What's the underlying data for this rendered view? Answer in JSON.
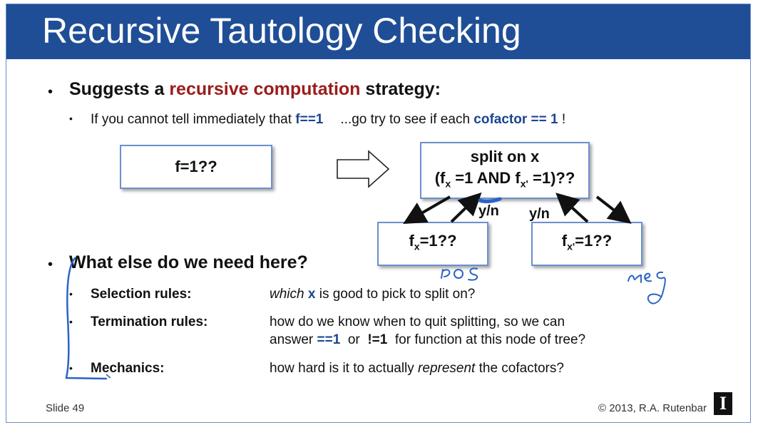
{
  "slide_title": "Recursive Tautology Checking",
  "bullet1": {
    "prefix": "Suggests a ",
    "highlight": "recursive computation",
    "suffix": " strategy:"
  },
  "sub1": {
    "t1": "If you cannot tell immediately that ",
    "f_eq": "f==1",
    "t2": "...go try to see if each ",
    "cofactor": "cofactor == 1",
    "t3": " !"
  },
  "diagram": {
    "start_box": "f=1??",
    "split_line1": "split on x",
    "split_line2": {
      "a": "(f",
      "x_sub": "x",
      "b": " =1 AND f",
      "xprime_sub": "x'",
      "c": " =1)??"
    },
    "left_box": {
      "a": "f",
      "sub": "x",
      "b": "=1??"
    },
    "right_box": {
      "a": "f",
      "sub": "x'",
      "b": "=1??"
    },
    "yn_left": "y/n",
    "yn_right": "y/n"
  },
  "bullet2": "What else do we need here?",
  "rules": [
    {
      "label": "Selection rules:",
      "desc_em": "which",
      "desc_x": " x",
      "desc_rest": " is good to pick to split on?"
    },
    {
      "label": "Termination rules:",
      "desc_l1": "how do we know when to quit splitting, so we can",
      "desc_l2a": "answer ",
      "eq1": "==1",
      "desc_l2b": "  or  ",
      "neq1": "!=1",
      "desc_l2c": "  for function at this node of tree?"
    },
    {
      "label": "Mechanics:",
      "desc_a": "how hard is it to actually ",
      "desc_em": "represent",
      "desc_b": " the cofactors?"
    }
  ],
  "footer": {
    "slide_number": "Slide 49",
    "copyright": "© 2013, R.A. Rutenbar",
    "logo_letter": "I"
  },
  "annotations": {
    "left_note": "pos",
    "right_note": "neg"
  },
  "colors": {
    "title_bar": "#1f4e96",
    "highlight_red": "#9b1c1c",
    "highlight_blue": "#1a4690",
    "ink": "#2a63c7"
  }
}
